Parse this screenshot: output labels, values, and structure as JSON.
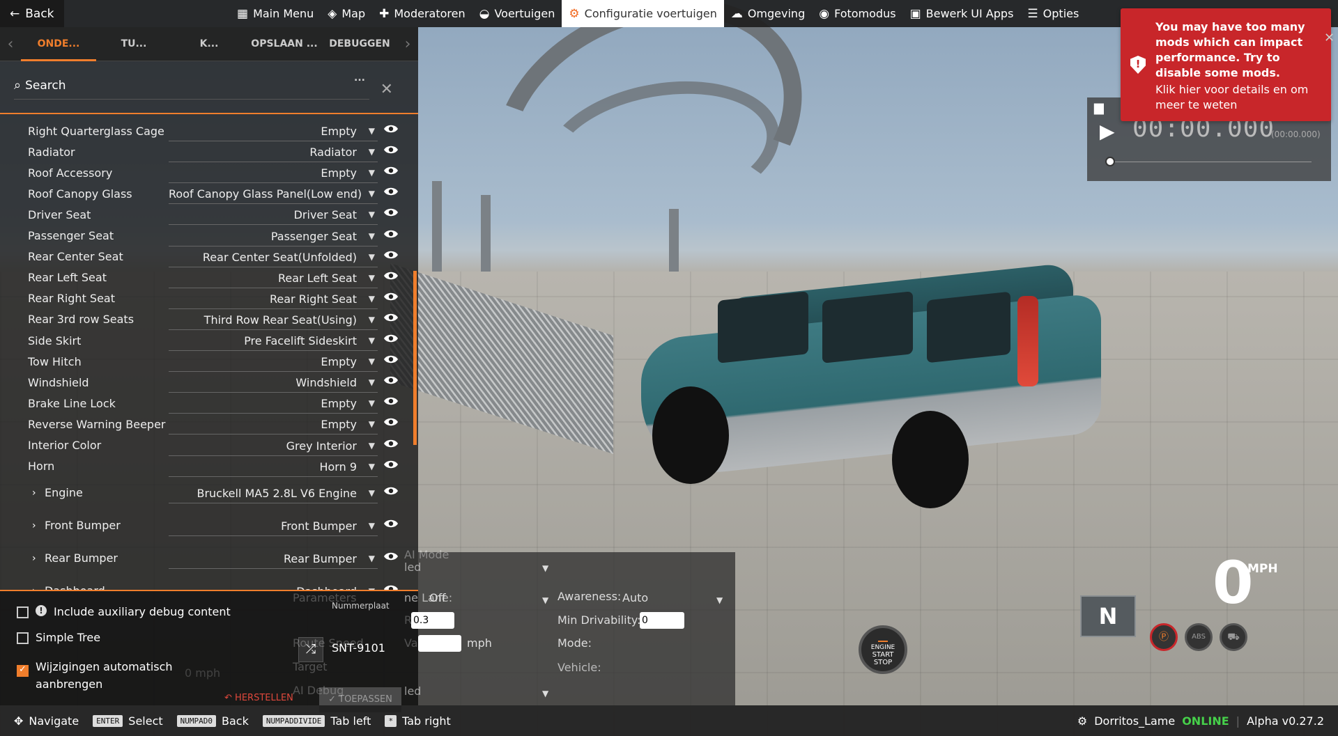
{
  "topbar": {
    "back": "Back",
    "menu": [
      {
        "label": "Main Menu",
        "icon": "grid-icon",
        "glyph": "▦"
      },
      {
        "label": "Map",
        "icon": "map-icon",
        "glyph": "◈"
      },
      {
        "label": "Moderatoren",
        "icon": "puzzle-icon",
        "glyph": "✚"
      },
      {
        "label": "Voertuigen",
        "icon": "car-icon",
        "glyph": "◒"
      },
      {
        "label": "Configuratie voertuigen",
        "icon": "engine-icon",
        "glyph": "⚙"
      },
      {
        "label": "Omgeving",
        "icon": "weather-icon",
        "glyph": "☁"
      },
      {
        "label": "Fotomodus",
        "icon": "camera-icon",
        "glyph": "◉"
      },
      {
        "label": "Bewerk UI Apps",
        "icon": "apps-icon",
        "glyph": "▣"
      },
      {
        "label": "Opties",
        "icon": "sliders-icon",
        "glyph": "☰"
      }
    ]
  },
  "panel": {
    "tabs": [
      "ONDE...",
      "TU...",
      "K...",
      "OPSLAAN ...",
      "DEBUGGEN ..."
    ],
    "search_placeholder": "Search",
    "parts": [
      {
        "label": "Right Quarterglass Cage",
        "value": "Empty"
      },
      {
        "label": "Radiator",
        "value": "Radiator"
      },
      {
        "label": "Roof Accessory",
        "value": "Empty"
      },
      {
        "label": "Roof Canopy Glass",
        "value": "Roof Canopy Glass Panel(Low end)"
      },
      {
        "label": "Driver Seat",
        "value": "Driver Seat"
      },
      {
        "label": "Passenger Seat",
        "value": "Passenger Seat"
      },
      {
        "label": "Rear Center Seat",
        "value": "Rear Center Seat(Unfolded)"
      },
      {
        "label": "Rear Left Seat",
        "value": "Rear Left Seat"
      },
      {
        "label": "Rear Right Seat",
        "value": "Rear Right Seat"
      },
      {
        "label": "Rear 3rd row Seats",
        "value": "Third Row Rear Seat(Using)"
      },
      {
        "label": "Side Skirt",
        "value": "Pre Facelift Sideskirt"
      },
      {
        "label": "Tow Hitch",
        "value": "Empty"
      },
      {
        "label": "Windshield",
        "value": "Windshield"
      },
      {
        "label": "Brake Line Lock",
        "value": "Empty"
      },
      {
        "label": "Reverse Warning Beeper",
        "value": "Empty"
      },
      {
        "label": "Interior Color",
        "value": "Grey Interior"
      },
      {
        "label": "Horn",
        "value": "Horn 9"
      }
    ],
    "groups": [
      {
        "label": "Engine",
        "value": "Bruckell MA5 2.8L V6 Engine"
      },
      {
        "label": "Front Bumper",
        "value": "Front Bumper"
      },
      {
        "label": "Rear Bumper",
        "value": "Rear Bumper"
      },
      {
        "label": "Dashboard",
        "value": "Dashboard"
      }
    ],
    "footer": {
      "aux_debug": "Include auxiliary debug content",
      "simple_tree": "Simple Tree",
      "auto_apply_line1": "Wijzigingen automatisch",
      "auto_apply_line2": "aanbrengen",
      "plate_label": "Nummerplaat",
      "plate_value": "SNT-9101",
      "reset": "HERSTELLEN",
      "apply": "TOEPASSEN"
    }
  },
  "ai": {
    "mode_label": "AI Mode",
    "mode_value": "Disabled",
    "params": "Parameters",
    "lane": "Lane:",
    "lane_value": "Off",
    "awareness": "Awareness:",
    "awareness_value": "Auto",
    "risk": "Risk:",
    "risk_value": "0.3",
    "min_drivability": "Min Drivability:",
    "min_drivability_value": "0",
    "route_speed": "Route Speed",
    "value": "Value:",
    "unit": "mph",
    "mode2": "Mode:",
    "target": "Target",
    "vehicle": "Vehicle:",
    "debug_label": "AI Debug",
    "debug_value": "Disabled",
    "partial_mode": "led",
    "partial_debug": "led",
    "partial_lane": "ne Lane:"
  },
  "recorder": {
    "time": "00:00.000",
    "small": "(00:00.000)"
  },
  "notification": {
    "message": "You may have too many mods which can impact performance. Try to disable some mods.",
    "sub": "Klik hier voor details en om meer te weten"
  },
  "hud": {
    "gear": "N",
    "speed": "0",
    "unit": "MPH",
    "engine_line1": "ENGINE",
    "engine_line2": "START",
    "engine_line3": "STOP",
    "ghost_speed": "0 mph"
  },
  "bottombar": {
    "hints": [
      {
        "key": "",
        "label": "Navigate"
      },
      {
        "key": "ENTER",
        "label": "Select"
      },
      {
        "key": "NUMPAD0",
        "label": "Back"
      },
      {
        "key": "NUMPADDIVIDE",
        "label": "Tab left"
      },
      {
        "key": "*",
        "label": "Tab right"
      }
    ],
    "user": "Dorritos_Lame",
    "status": "ONLINE",
    "version": "Alpha v0.27.2"
  },
  "colors": {
    "accent": "#f07e2c",
    "notify": "#c8262a",
    "online": "#46d04a"
  }
}
